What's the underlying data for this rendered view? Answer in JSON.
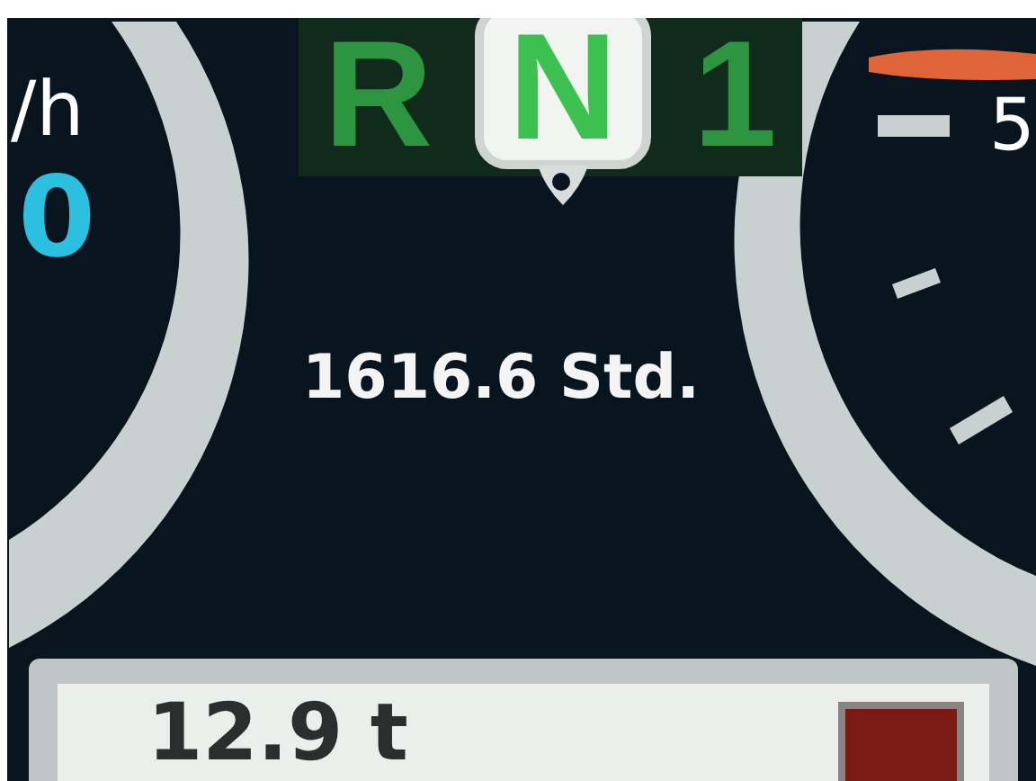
{
  "speed": {
    "unit": "/h",
    "value": "0"
  },
  "gears": [
    {
      "label": "R",
      "selected": false
    },
    {
      "label": "N",
      "selected": true
    },
    {
      "label": "1",
      "selected": false
    }
  ],
  "operating_hours": "1616.6 Std.",
  "tachometer": {
    "scale_label": "5"
  },
  "load": {
    "value": "12.9 t"
  }
}
